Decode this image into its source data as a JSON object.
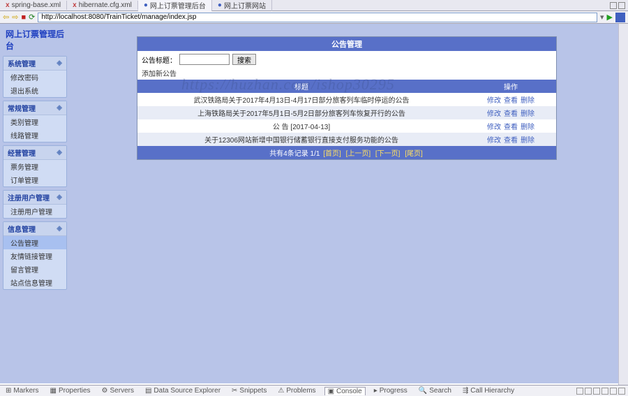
{
  "top_tabs": [
    {
      "icon": "x",
      "label": "spring-base.xml"
    },
    {
      "icon": "x",
      "label": "hibernate.cfg.xml"
    },
    {
      "icon": "web",
      "label": "网上订票管理后台",
      "active": true
    },
    {
      "icon": "web",
      "label": "网上订票网站"
    }
  ],
  "address_bar": {
    "url": "http://localhost:8080/TrainTicket/manage/index.jsp"
  },
  "sidebar": {
    "title": "网上订票管理后台",
    "groups": [
      {
        "header": "系统管理",
        "items": [
          "修改密码",
          "退出系统"
        ]
      },
      {
        "header": "常规管理",
        "items": [
          "类别管理",
          "线路管理"
        ]
      },
      {
        "header": "经营管理",
        "items": [
          "票务管理",
          "订单管理"
        ]
      },
      {
        "header": "注册用户管理",
        "items": [
          "注册用户管理"
        ]
      },
      {
        "header": "信息管理",
        "items": [
          "公告管理",
          "友情链接管理",
          "留言管理",
          "站点信息管理"
        ],
        "active_item": 0
      }
    ]
  },
  "content": {
    "title": "公告管理",
    "search_label": "公告标题：",
    "search_btn": "搜索",
    "subtitle": "添加新公告",
    "table": {
      "header_title": "标题",
      "header_ops": "操作",
      "rows": [
        {
          "title": "武汉铁路局关于2017年4月13日-4月17日部分旅客列车临时停运的公告"
        },
        {
          "title": "上海铁路局关于2017年5月1日-5月2日部分旅客列车恢复开行的公告"
        },
        {
          "title": "公 告 [2017-04-13]"
        },
        {
          "title": "关于12306网站新增中国银行储蓄银行直接支付服务功能的公告"
        }
      ],
      "op_edit": "修改",
      "op_view": "查看",
      "op_delete": "删除"
    },
    "pagination": {
      "text_prefix": "共有4条记录 1/1",
      "first": "[首页]",
      "prev": "[上一页]",
      "next": "[下一页]",
      "last": "[尾页]"
    }
  },
  "watermark": "https://huzhan.com/ishop30295",
  "bottom_tabs": [
    {
      "label": "Markers"
    },
    {
      "label": "Properties"
    },
    {
      "label": "Servers"
    },
    {
      "label": "Data Source Explorer"
    },
    {
      "label": "Snippets"
    },
    {
      "label": "Problems"
    },
    {
      "label": "Console",
      "active": true
    },
    {
      "label": "Progress"
    },
    {
      "label": "Search"
    },
    {
      "label": "Call Hierarchy"
    }
  ]
}
